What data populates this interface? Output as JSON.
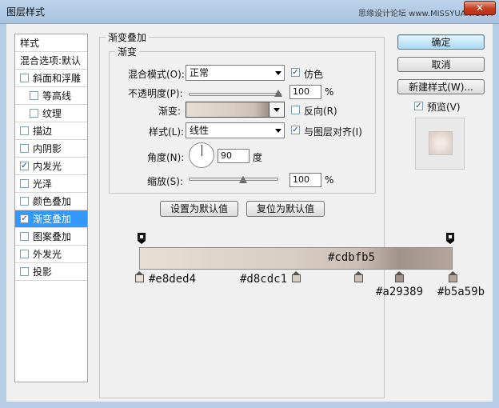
{
  "window": {
    "title": "图层样式",
    "watermark": "思缘设计论坛 www.MISSYUAN.COM",
    "close_glyph": "✕"
  },
  "sidebar": {
    "items": [
      {
        "label": "样式",
        "checkbox": false
      },
      {
        "label": "混合选项:默认",
        "checkbox": false
      },
      {
        "label": "斜面和浮雕",
        "checkbox": true,
        "checked": false
      },
      {
        "label": "等高线",
        "checkbox": true,
        "checked": false
      },
      {
        "label": "纹理",
        "checkbox": true,
        "checked": false
      },
      {
        "label": "描边",
        "checkbox": true,
        "checked": false
      },
      {
        "label": "内阴影",
        "checkbox": true,
        "checked": false
      },
      {
        "label": "内发光",
        "checkbox": true,
        "checked": true
      },
      {
        "label": "光泽",
        "checkbox": true,
        "checked": false
      },
      {
        "label": "颜色叠加",
        "checkbox": true,
        "checked": false
      },
      {
        "label": "渐变叠加",
        "checkbox": true,
        "checked": true,
        "selected": true
      },
      {
        "label": "图案叠加",
        "checkbox": true,
        "checked": false
      },
      {
        "label": "外发光",
        "checkbox": true,
        "checked": false
      },
      {
        "label": "投影",
        "checkbox": true,
        "checked": false
      }
    ],
    "check_mark": "✓"
  },
  "panel": {
    "outer_title": "渐变叠加",
    "inner_title": "渐变",
    "blend_mode": {
      "label": "混合模式(O):",
      "value": "正常"
    },
    "dither": {
      "label": "仿色",
      "checked": true
    },
    "opacity": {
      "label": "不透明度(P):",
      "value": "100",
      "unit": "%",
      "level": 1.0
    },
    "gradient": {
      "label": "渐变:"
    },
    "reverse": {
      "label": "反向(R)",
      "checked": false
    },
    "style": {
      "label": "样式(L):",
      "value": "线性"
    },
    "align": {
      "label": "与图层对齐(I)",
      "checked": true
    },
    "angle": {
      "label": "角度(N):",
      "value": "90",
      "unit": "度"
    },
    "scale": {
      "label": "缩放(S):",
      "value": "100",
      "unit": "%",
      "level": 0.5
    },
    "set_default": "设置为默认值",
    "reset_default": "复位为默认值"
  },
  "actions": {
    "ok": "确定",
    "cancel": "取消",
    "new_style": "新建样式(W)...",
    "preview": {
      "label": "预览(V)",
      "checked": true
    }
  },
  "gradient_stops": [
    {
      "color": "#e8ded4",
      "label": "#e8ded4",
      "position": 0.0
    },
    {
      "color": "#d8cdc1",
      "label": "#d8cdc1",
      "position": 0.5
    },
    {
      "color": "#cdbfb5",
      "label": "#cdbfb5",
      "position": 0.7
    },
    {
      "color": "#a29389",
      "label": "#a29389",
      "position": 0.83
    },
    {
      "color": "#b5a59b",
      "label": "#b5a59b",
      "position": 1.0
    }
  ]
}
